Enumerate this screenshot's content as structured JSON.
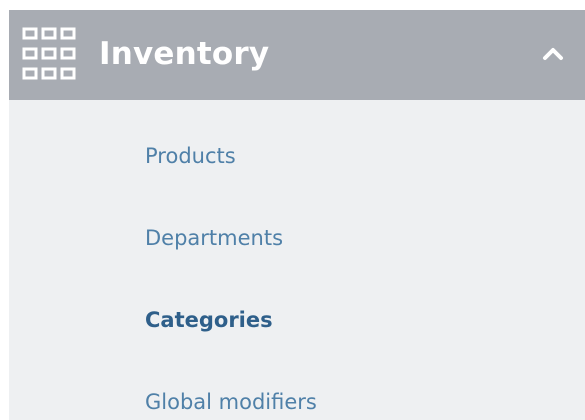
{
  "section": {
    "title": "Inventory",
    "icon": "grid-icon",
    "toggle_icon": "chevron-up-icon",
    "expanded": true
  },
  "menu": {
    "items": [
      {
        "label": "Products",
        "active": false
      },
      {
        "label": "Departments",
        "active": false
      },
      {
        "label": "Categories",
        "active": true
      },
      {
        "label": "Global modifiers",
        "active": false
      }
    ]
  },
  "colors": {
    "header_background": "#a8acb3",
    "panel_background": "#eef0f2",
    "link": "#4f80a8",
    "link_active": "#2e5f8a",
    "header_text": "#ffffff"
  }
}
